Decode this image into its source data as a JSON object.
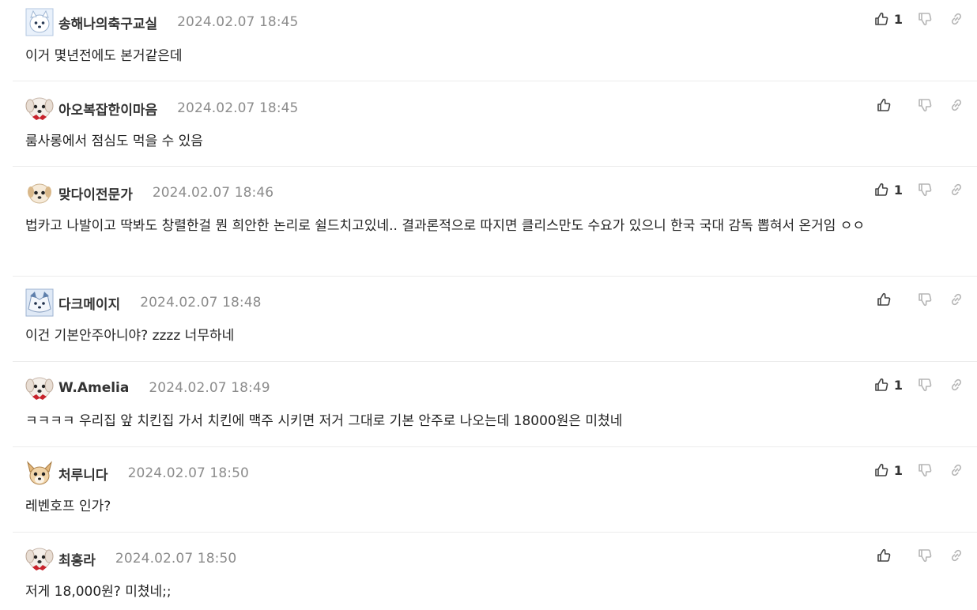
{
  "comments": [
    {
      "avatar": "white-animal-avatar",
      "nick": "송해나의축구교실",
      "date": "2024.02.07",
      "time": "18:45",
      "upvotes": "1",
      "body": "이거 몇년전에도 본거같은데"
    },
    {
      "avatar": "white-dog-red-bow-avatar",
      "nick": "아오복잡한이마음",
      "date": "2024.02.07",
      "time": "18:45",
      "upvotes": "",
      "body": "룸사롱에서 점심도 먹을 수 있음"
    },
    {
      "avatar": "puppy-face-avatar",
      "nick": "맞다이전문가",
      "date": "2024.02.07",
      "time": "18:46",
      "upvotes": "1",
      "body": "법카고 나발이고 딱봐도 창렬한걸 뭔 희안한 논리로 쉴드치고있네.. 결과론적으로 따지면 클리스만도 수요가 있으니 한국 국대 감독 뽑혀서 온거임 ㅇㅇ"
    },
    {
      "avatar": "blue-animal-avatar",
      "nick": "다크메이지",
      "date": "2024.02.07",
      "time": "18:48",
      "upvotes": "",
      "body": "이건 기본안주아니야? zzzz 너무하네"
    },
    {
      "avatar": "white-dog-red-bow-avatar",
      "nick": "W.Amelia",
      "date": "2024.02.07",
      "time": "18:49",
      "upvotes": "1",
      "body": "ㅋㅋㅋㅋ 우리집 앞 치킨집 가서 치킨에 맥주 시키면 저거 그대로 기본 안주로 나오는데 18000원은 미쳤네"
    },
    {
      "avatar": "chihuahua-avatar",
      "nick": "처루니다",
      "date": "2024.02.07",
      "time": "18:50",
      "upvotes": "1",
      "body": "레벤호프 인가?"
    },
    {
      "avatar": "white-dog-red-bow-avatar",
      "nick": "최홍라",
      "date": "2024.02.07",
      "time": "18:50",
      "upvotes": "",
      "body": "저게 18,000원? 미쳤네;;"
    }
  ],
  "icons": {
    "upvote": "thumbs-up-icon",
    "downvote": "thumbs-down-icon",
    "link": "link-icon"
  },
  "colors": {
    "text": "#222222",
    "date": "#8c8c8c",
    "icon": "#555555",
    "icon_muted": "#b5b5b5",
    "divider": "#ececec"
  }
}
